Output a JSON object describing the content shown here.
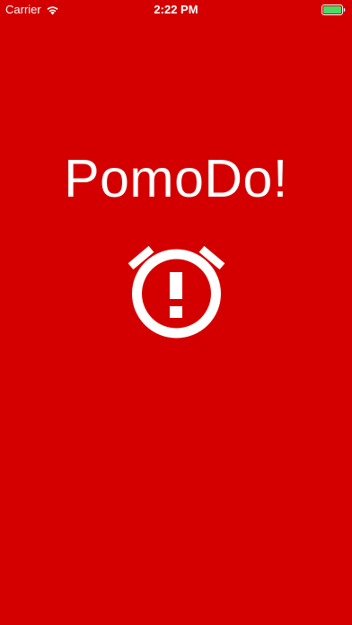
{
  "status_bar": {
    "carrier": "Carrier",
    "time": "2:22 PM",
    "wifi_icon": "wifi-icon",
    "battery_icon": "battery-full-icon",
    "battery_color": "#4cd964"
  },
  "main": {
    "title": "PomoDo!",
    "logo_icon": "alarm-clock-exclamation-icon"
  },
  "colors": {
    "background": "#d40000",
    "foreground": "#ffffff"
  }
}
